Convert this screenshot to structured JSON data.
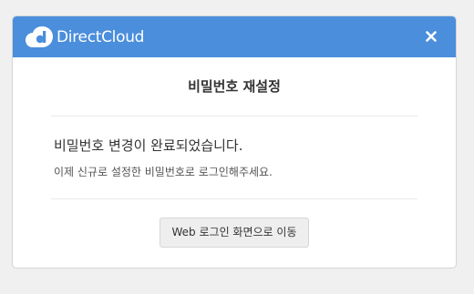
{
  "header": {
    "logo_text": "DirectCloud",
    "close_icon": "close-icon",
    "background_color": "#4a8edc"
  },
  "dialog": {
    "title": "비밀번호 재설정",
    "message_main": "비밀번호 변경이 완료되었습니다.",
    "message_sub": "이제 신규로 설정한 비밀번호로 로그인해주세요.",
    "button_label": "Web 로그인 화면으로 이동"
  }
}
